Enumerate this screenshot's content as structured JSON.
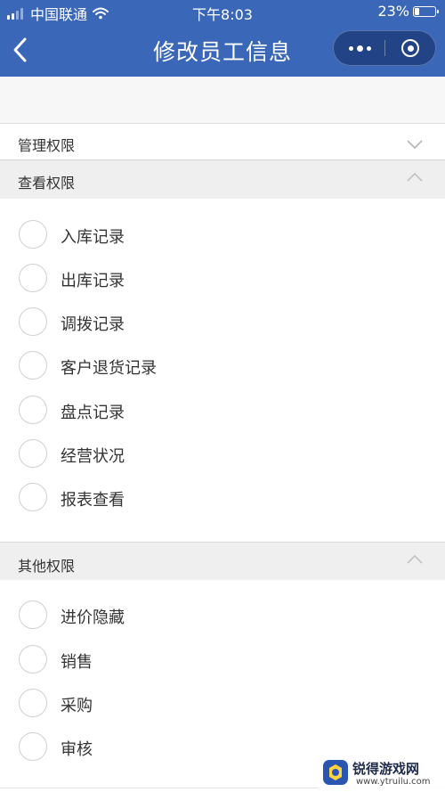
{
  "status_bar": {
    "carrier": "中国联通",
    "time": "下午8:03",
    "battery": "23%",
    "battery_level": 0.23
  },
  "nav": {
    "title": "修改员工信息",
    "icons": {
      "back": "chevron-left-icon",
      "more": "more-dots-icon",
      "close": "close-circle-icon"
    }
  },
  "sections": {
    "manage": {
      "label": "管理权限",
      "expanded": false
    },
    "view": {
      "label": "查看权限",
      "expanded": true,
      "options": [
        "入库记录",
        "出库记录",
        "调拨记录",
        "客户退货记录",
        "盘点记录",
        "经营状况",
        "报表查看"
      ]
    },
    "other": {
      "label": "其他权限",
      "expanded": true,
      "options": [
        "进价隐藏",
        "销售",
        "采购",
        "审核"
      ]
    }
  },
  "watermark": {
    "title": "锐得游戏网",
    "url": "www.ytruilu.com"
  },
  "colors": {
    "nav_bg": "#3a67b8",
    "section_bg": "#efefef",
    "radio_border": "#d0d0d0"
  }
}
